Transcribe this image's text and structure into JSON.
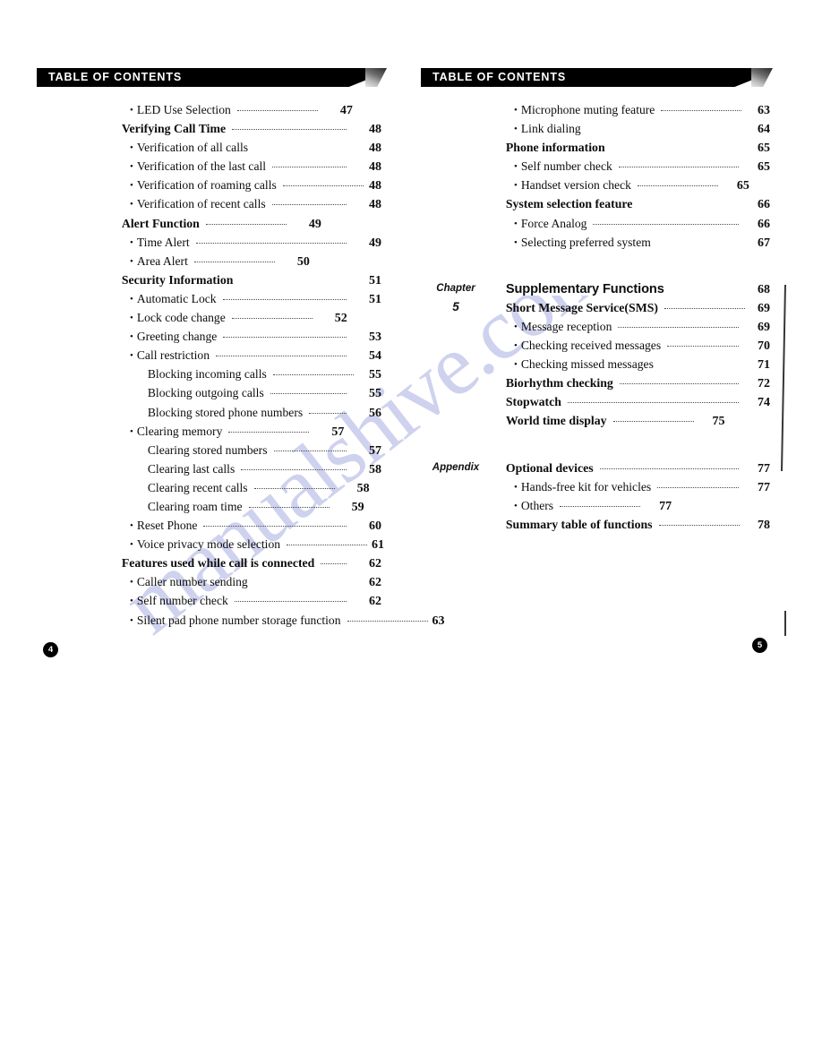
{
  "document": {
    "watermark": "manualshive.com",
    "header_title": "TABLE OF CONTENTS"
  },
  "left_page": {
    "banner_title": "TABLE OF CONTENTS",
    "folio": "4",
    "entries": [
      {
        "level": "sub",
        "label": "LED Use Selection",
        "page": "47"
      },
      {
        "level": "heading",
        "label": "Verifying Call Time",
        "page": "48"
      },
      {
        "level": "sub",
        "label": "Verification of all calls",
        "page": "48"
      },
      {
        "level": "sub",
        "label": "Verification of the last call",
        "page": "48"
      },
      {
        "level": "sub",
        "label": "Verification of roaming calls",
        "page": "48"
      },
      {
        "level": "sub",
        "label": "Verification of recent calls",
        "page": "48"
      },
      {
        "level": "heading",
        "label": "Alert Function",
        "page": "49"
      },
      {
        "level": "sub",
        "label": "Time Alert",
        "page": "49"
      },
      {
        "level": "sub",
        "label": "Area Alert",
        "page": "50"
      },
      {
        "level": "heading",
        "label": "Security Information",
        "page": "51"
      },
      {
        "level": "sub",
        "label": "Automatic Lock",
        "page": "51"
      },
      {
        "level": "sub",
        "label": "Lock code change",
        "page": "52"
      },
      {
        "level": "sub",
        "label": "Greeting change",
        "page": "53"
      },
      {
        "level": "sub",
        "label": "Call restriction",
        "page": "54"
      },
      {
        "level": "subsub",
        "label": "Blocking incoming calls",
        "page": "55"
      },
      {
        "level": "subsub",
        "label": "Blocking outgoing calls",
        "page": "55"
      },
      {
        "level": "subsub",
        "label": "Blocking stored phone numbers",
        "page": "56"
      },
      {
        "level": "sub",
        "label": "Clearing memory",
        "page": "57"
      },
      {
        "level": "subsub",
        "label": "Clearing stored numbers",
        "page": "57"
      },
      {
        "level": "subsub",
        "label": "Clearing last calls",
        "page": "58"
      },
      {
        "level": "subsub",
        "label": "Clearing recent calls",
        "page": "58"
      },
      {
        "level": "subsub",
        "label": "Clearing roam time",
        "page": "59"
      },
      {
        "level": "sub",
        "label": "Reset Phone",
        "page": "60"
      },
      {
        "level": "sub",
        "label": "Voice privacy mode selection",
        "page": "61"
      },
      {
        "level": "heading",
        "label": "Features used while call is connected",
        "page": "62"
      },
      {
        "level": "sub",
        "label": "Caller number sending",
        "page": "62"
      },
      {
        "level": "sub",
        "label": "Self number check",
        "page": "62"
      },
      {
        "level": "sub",
        "label": "Silent pad phone number storage function",
        "page": "63"
      }
    ]
  },
  "right_page": {
    "banner_title": "TABLE OF CONTENTS",
    "folio": "5",
    "entries": [
      {
        "level": "sub",
        "label": "Microphone muting feature",
        "page": "63"
      },
      {
        "level": "sub",
        "label": "Link dialing",
        "page": "64"
      },
      {
        "level": "heading",
        "label": "Phone information",
        "page": "65"
      },
      {
        "level": "sub",
        "label": "Self number check",
        "page": "65"
      },
      {
        "level": "sub",
        "label": "Handset version check",
        "page": "65"
      },
      {
        "level": "heading",
        "label": "System selection feature",
        "page": "66"
      },
      {
        "level": "sub",
        "label": "Force Analog",
        "page": "66"
      },
      {
        "level": "sub",
        "label": "Selecting preferred system",
        "page": "67"
      },
      {
        "level": "spacer"
      },
      {
        "level": "chapter",
        "tag": "Chapter",
        "tag_num": "5",
        "label": "Supplementary Functions",
        "page": "68"
      },
      {
        "level": "heading",
        "label": "Short Message Service(SMS)",
        "page": "69"
      },
      {
        "level": "sub",
        "label": "Message reception",
        "page": "69"
      },
      {
        "level": "sub",
        "label": "Checking received messages",
        "page": "70"
      },
      {
        "level": "sub",
        "label": "Checking missed messages",
        "page": "71"
      },
      {
        "level": "heading",
        "label": "Biorhythm checking",
        "page": "72"
      },
      {
        "level": "heading",
        "label": "Stopwatch",
        "page": "74"
      },
      {
        "level": "heading",
        "label": "World time display",
        "page": "75"
      },
      {
        "level": "spacer"
      },
      {
        "level": "appendix",
        "tag": "Appendix",
        "label": "Optional devices",
        "page": "77"
      },
      {
        "level": "sub",
        "label": "Hands-free kit for vehicles",
        "page": "77"
      },
      {
        "level": "sub",
        "label": "Others",
        "page": "77"
      },
      {
        "level": "heading",
        "label": "Summary table of functions",
        "page": "78"
      }
    ]
  }
}
